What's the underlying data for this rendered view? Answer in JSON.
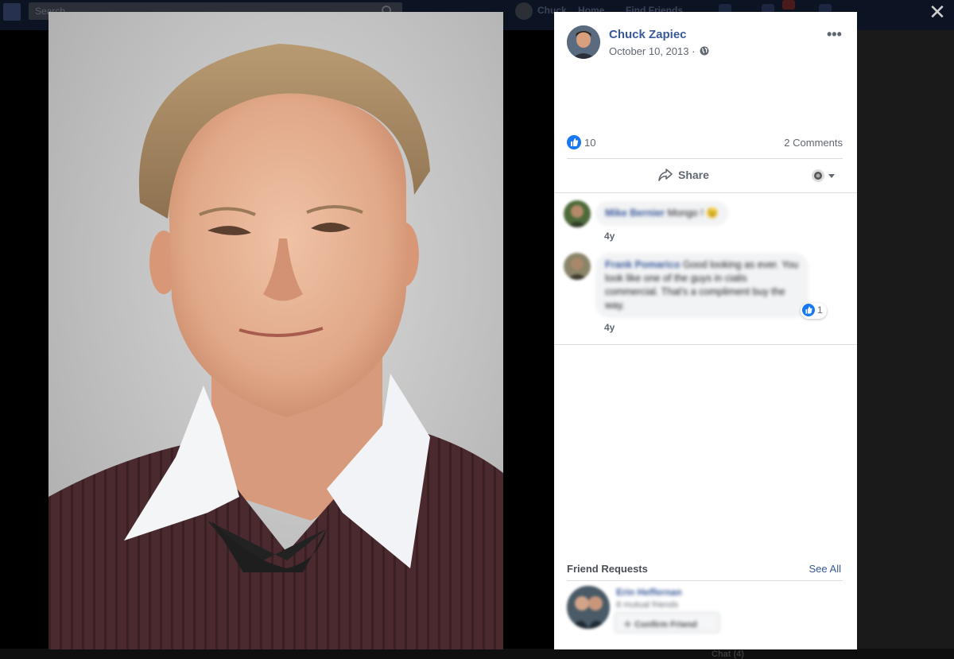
{
  "background": {
    "search_placeholder": "Search",
    "nav_items": [
      "Chuck",
      "Home",
      "Find Friends"
    ],
    "chat_label": "Chat (4)"
  },
  "viewer": {
    "close_icon": "close-icon"
  },
  "post": {
    "author": "Chuck Zapiec",
    "date": "October 10, 2013",
    "date_separator": " · ",
    "privacy_icon": "globe-icon",
    "like_count": "10",
    "comments_count": "2 Comments",
    "share_label": "Share"
  },
  "comments": [
    {
      "author": "Mike Bernier",
      "text": "Mongo ! 😉",
      "time": "4y"
    },
    {
      "author": "Frank Pomarico",
      "text": "Good looking as ever. You look like one of the guys in cialis commercial. That's a compliment buy the way.",
      "time": "4y",
      "reactions": "1"
    }
  ],
  "friend_requests": {
    "title": "Friend Requests",
    "see_all": "See All",
    "items": [
      {
        "name": "Erin Heffernan",
        "mutual": "8 mutual friends",
        "confirm_label": "Confirm Friend"
      }
    ]
  },
  "colors": {
    "link": "#385898",
    "like_blue": "#1877f2",
    "muted_text": "#606770",
    "sweater": "#4a2a2e"
  }
}
